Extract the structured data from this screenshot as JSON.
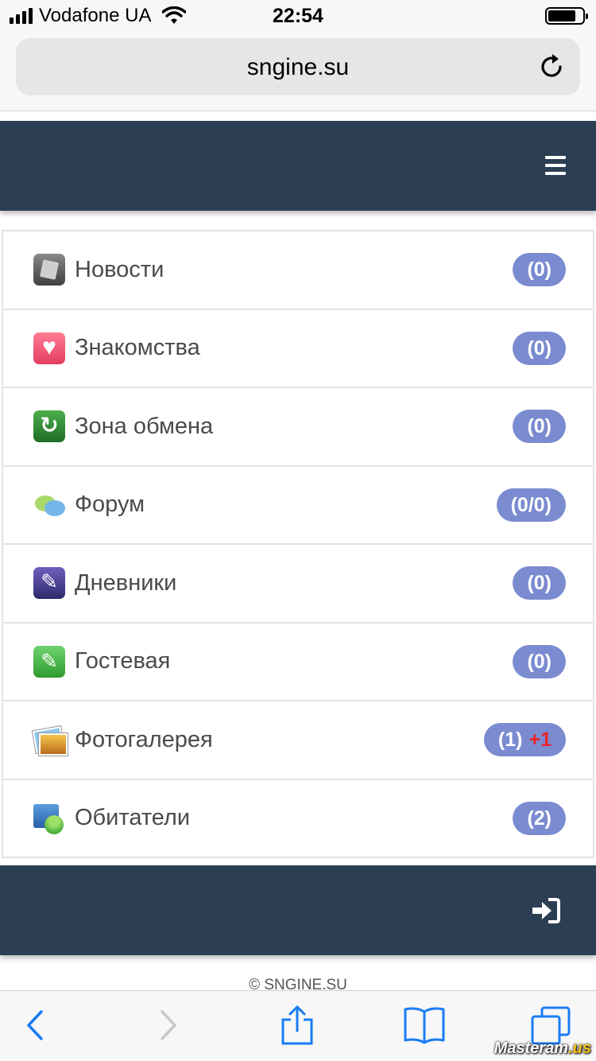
{
  "status_bar": {
    "carrier": "Vodafone UA",
    "time": "22:54"
  },
  "browser": {
    "url": "sngine.su"
  },
  "menu": {
    "items": [
      {
        "label": "Новости",
        "count": "(0)",
        "extra": "",
        "icon": "news-icon"
      },
      {
        "label": "Знакомства",
        "count": "(0)",
        "extra": "",
        "icon": "heart-icon"
      },
      {
        "label": "Зона обмена",
        "count": "(0)",
        "extra": "",
        "icon": "exchange-icon"
      },
      {
        "label": "Форум",
        "count": "(0/0)",
        "extra": "",
        "icon": "chat-bubbles-icon"
      },
      {
        "label": "Дневники",
        "count": "(0)",
        "extra": "",
        "icon": "diary-pen-icon"
      },
      {
        "label": "Гостевая",
        "count": "(0)",
        "extra": "",
        "icon": "guestbook-pen-icon"
      },
      {
        "label": "Фотогалерея",
        "count": "(1)",
        "extra": "+1",
        "icon": "photos-icon"
      },
      {
        "label": "Обитатели",
        "count": "(2)",
        "extra": "",
        "icon": "users-icon"
      }
    ]
  },
  "footer": {
    "copyright": "© SNGINE.SU"
  },
  "watermark": {
    "text": "Masteram",
    "suffix": ".us"
  },
  "colors": {
    "header_bg": "#2c3e53",
    "badge_bg": "#7b8bd0",
    "badge_plus": "#e8242a"
  }
}
